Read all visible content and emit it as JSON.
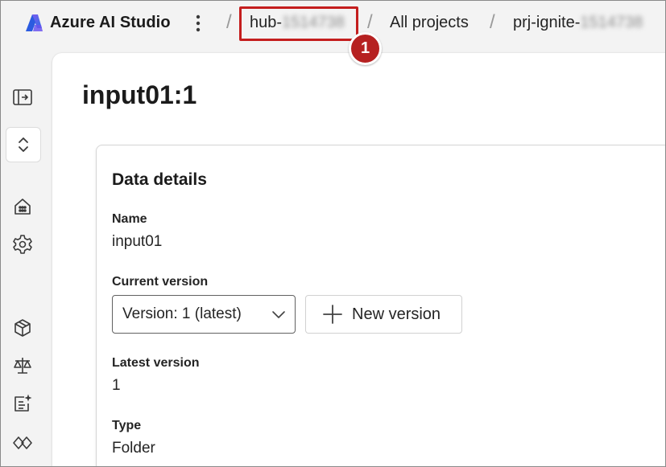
{
  "header": {
    "app_title": "Azure AI Studio",
    "breadcrumbs": [
      {
        "prefix": "hub-",
        "redacted": "1514738"
      },
      {
        "label": "All projects"
      },
      {
        "prefix": "prj-ignite-",
        "redacted": "1514738"
      }
    ],
    "separator": "/"
  },
  "annotation": {
    "step_number": "1",
    "color": "#c41e1e"
  },
  "page": {
    "title": "input01:1"
  },
  "card": {
    "title": "Data details",
    "name_label": "Name",
    "name_value": "input01",
    "current_version_label": "Current version",
    "version_select_value": "Version: 1 (latest)",
    "new_version_label": "New version",
    "latest_version_label": "Latest version",
    "latest_version_value": "1",
    "type_label": "Type",
    "type_value": "Folder"
  },
  "icons": {
    "rail": [
      "expand-sidebar-icon",
      "project-switcher-icon",
      "home-icon",
      "settings-icon",
      "model-catalog-icon",
      "evaluation-icon",
      "prompt-flow-icon",
      "connections-icon"
    ]
  },
  "colors": {
    "brand": "#4f6bed",
    "highlight": "#c41e1e"
  }
}
